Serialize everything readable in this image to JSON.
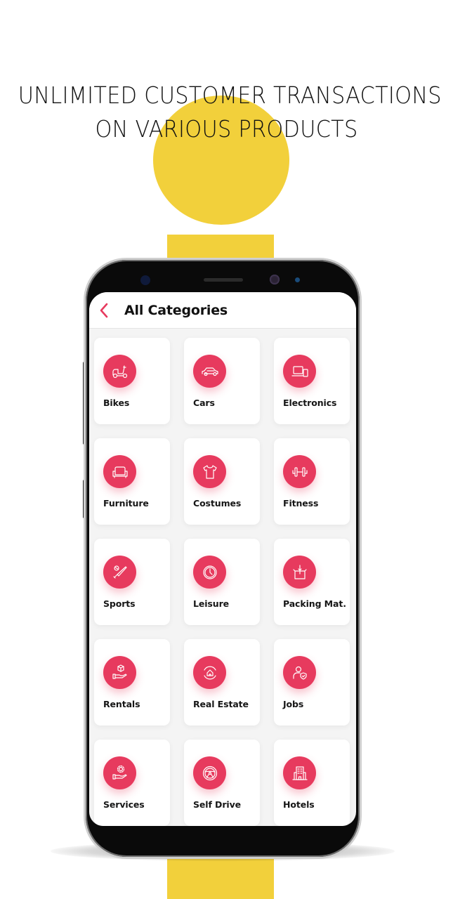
{
  "promo": {
    "headline_line1": "UNLIMITED CUSTOMER TRANSACTIONS",
    "headline_line2": "ON VARIOUS PRODUCTS",
    "accent_yellow": "#f2d03b"
  },
  "app": {
    "header": {
      "back_icon": "chevron-left-icon",
      "title": "All Categories"
    },
    "accent_color": "#e73a5e",
    "categories": [
      {
        "label": "Bikes",
        "icon": "scooter-icon"
      },
      {
        "label": "Cars",
        "icon": "car-icon"
      },
      {
        "label": "Electronics",
        "icon": "laptop-phone-icon"
      },
      {
        "label": "Furniture",
        "icon": "sofa-icon"
      },
      {
        "label": "Costumes",
        "icon": "tshirt-icon"
      },
      {
        "label": "Fitness",
        "icon": "dumbbell-icon"
      },
      {
        "label": "Sports",
        "icon": "baseball-bat-icon"
      },
      {
        "label": "Leisure",
        "icon": "clock-icon"
      },
      {
        "label": "Packing Mat.",
        "icon": "package-box-icon"
      },
      {
        "label": "Rentals",
        "icon": "hand-box-icon"
      },
      {
        "label": "Real Estate",
        "icon": "house-cycle-icon"
      },
      {
        "label": "Jobs",
        "icon": "user-shield-icon"
      },
      {
        "label": "Services",
        "icon": "hand-gear-icon"
      },
      {
        "label": "Self Drive",
        "icon": "steering-wheel-icon"
      },
      {
        "label": "Hotels",
        "icon": "hotel-building-icon"
      }
    ]
  }
}
